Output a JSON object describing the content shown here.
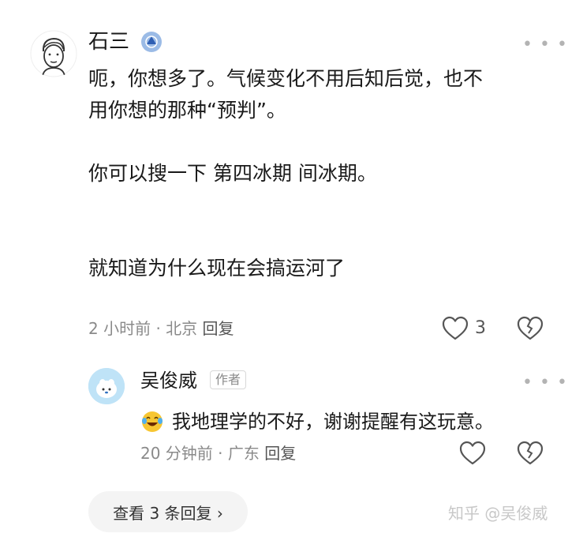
{
  "comment": {
    "author": "石三",
    "badge_icon": "verified-shield-icon",
    "lines": [
      "呃，你想多了。气候变化不用后知后觉，也不",
      "用你想的那种“预判”。",
      "",
      "你可以搜一下 第四冰期 间冰期。",
      "",
      "",
      "就知道为什么现在会搞运河了"
    ],
    "time": "2 小时前",
    "location": "北京",
    "reply_label": "回复",
    "like_count": "3"
  },
  "reply": {
    "author": "吴俊威",
    "tag": "作者",
    "emoji": "laughing-crying-emoji",
    "text": "我地理学的不好，谢谢提醒有这玩意。",
    "time": "20 分钟前",
    "location": "广东",
    "reply_label": "回复"
  },
  "view_replies": "查看 3 条回复 ›",
  "watermark": "知乎 @吴俊威",
  "separator": "·"
}
